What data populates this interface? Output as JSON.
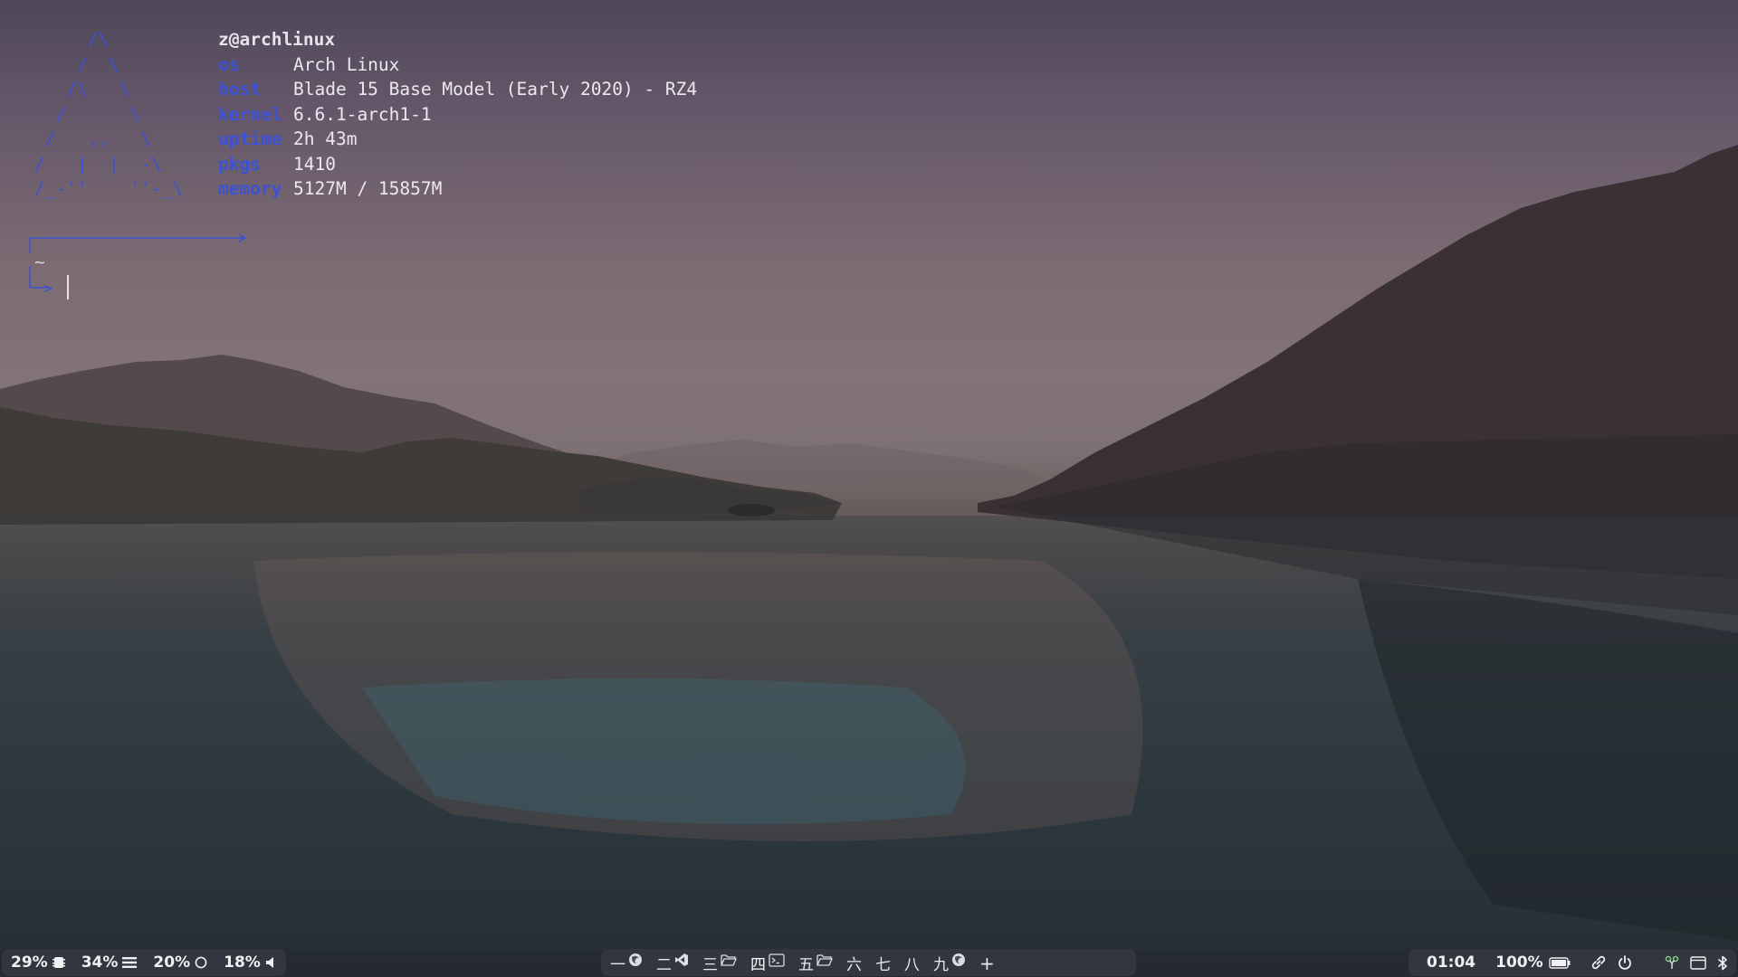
{
  "terminal": {
    "logo_lines": [
      "     /\\",
      "    /  \\",
      "   /\\   \\",
      "  /      \\",
      " /   ,,   \\",
      "/   |  |  -\\",
      "/_-''    ''-_\\"
    ],
    "user_host": "z@archlinux",
    "info": [
      {
        "key": "os",
        "value": "Arch Linux"
      },
      {
        "key": "host",
        "value": "Blade 15 Base Model (Early 2020) - RZ4"
      },
      {
        "key": "kernel",
        "value": "6.6.1-arch1-1"
      },
      {
        "key": "uptime",
        "value": "2h 43m"
      },
      {
        "key": "pkgs",
        "value": "1410"
      },
      {
        "key": "memory",
        "value": "5127M / 15857M"
      }
    ],
    "cwd": "~",
    "prompt_arrow": ">"
  },
  "bar": {
    "left": {
      "cpu": "29%",
      "ram": "34%",
      "disk": "20%",
      "volume": "18%"
    },
    "workspaces": [
      {
        "label": "一",
        "app_icon": "firefox-icon"
      },
      {
        "label": "二",
        "app_icon": "vscode-icon"
      },
      {
        "label": "三",
        "app_icon": "folder-icon"
      },
      {
        "label": "四",
        "app_icon": "terminal-icon",
        "active": true
      },
      {
        "label": "五",
        "app_icon": "folder-icon"
      },
      {
        "label": "六"
      },
      {
        "label": "七"
      },
      {
        "label": "八"
      },
      {
        "label": "九",
        "app_icon": "firefox-icon"
      }
    ],
    "add_workspace": "+",
    "right": {
      "clock": "01:04",
      "battery": "100%"
    }
  },
  "colors": {
    "accent_blue": "#3d52d4",
    "bar_bg": "#363a42",
    "text": "#f0f0f2"
  }
}
